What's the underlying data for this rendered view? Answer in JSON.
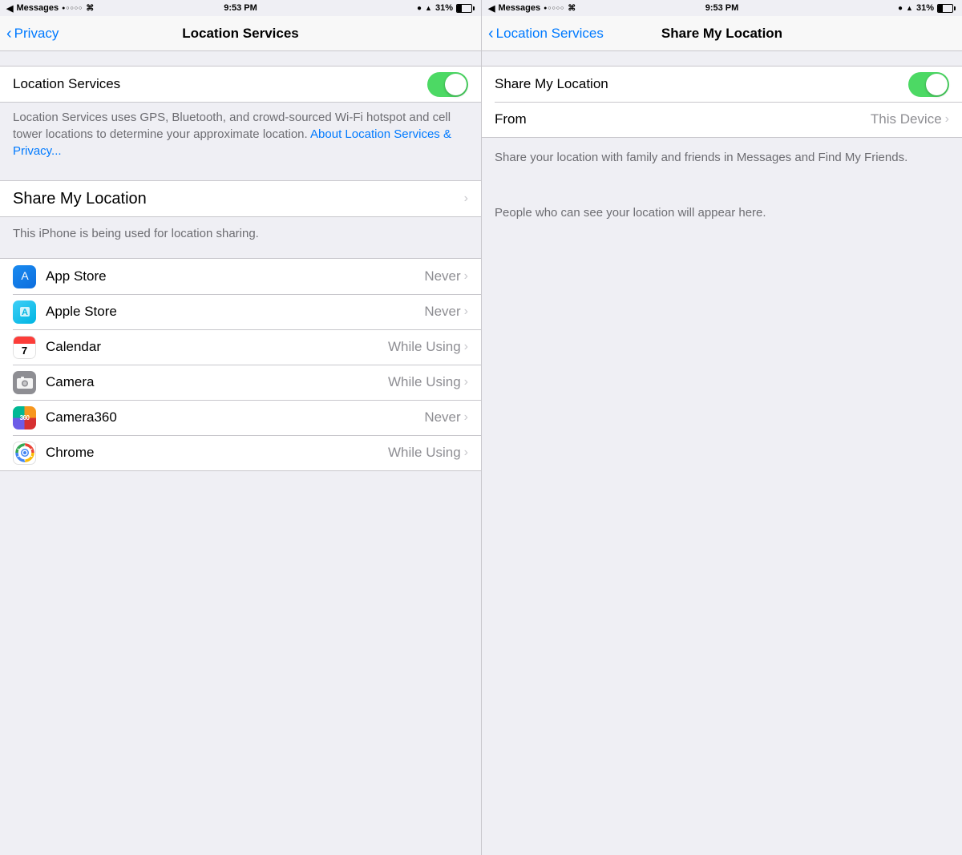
{
  "left_panel": {
    "status_bar": {
      "app_name": "Messages",
      "signal_dots": "●○○○○",
      "wifi": "WiFi",
      "time": "9:53 PM",
      "lock": "🔒",
      "location": "▲",
      "battery_pct": "31%"
    },
    "nav": {
      "back_label": "Privacy",
      "title": "Location Services"
    },
    "location_services_row": {
      "label": "Location Services"
    },
    "description": "Location Services uses GPS, Bluetooth, and crowd-sourced Wi-Fi hotspot and cell tower locations to determine your approximate location.",
    "about_link": "About Location Services & Privacy...",
    "share_my_location_row": {
      "label": "Share My Location"
    },
    "sharing_note": "This iPhone is being used for location sharing.",
    "apps": [
      {
        "name": "App Store",
        "permission": "Never",
        "icon": "appstore"
      },
      {
        "name": "Apple Store",
        "permission": "Never",
        "icon": "applestore"
      },
      {
        "name": "Calendar",
        "permission": "While Using",
        "icon": "calendar"
      },
      {
        "name": "Camera",
        "permission": "While Using",
        "icon": "camera"
      },
      {
        "name": "Camera360",
        "permission": "Never",
        "icon": "camera360"
      },
      {
        "name": "Chrome",
        "permission": "While Using",
        "icon": "chrome"
      }
    ]
  },
  "right_panel": {
    "status_bar": {
      "app_name": "Messages",
      "signal_dots": "●○○○○",
      "wifi": "WiFi",
      "time": "9:53 PM",
      "lock": "🔒",
      "location": "▲",
      "battery_pct": "31%"
    },
    "nav": {
      "back_label": "Location Services",
      "title": "Share My Location"
    },
    "share_my_location_row": {
      "label": "Share My Location"
    },
    "from_row": {
      "label": "From",
      "value": "This Device"
    },
    "description": "Share your location with family and friends in Messages and Find My Friends.",
    "people_note": "People who can see your location will appear here."
  }
}
